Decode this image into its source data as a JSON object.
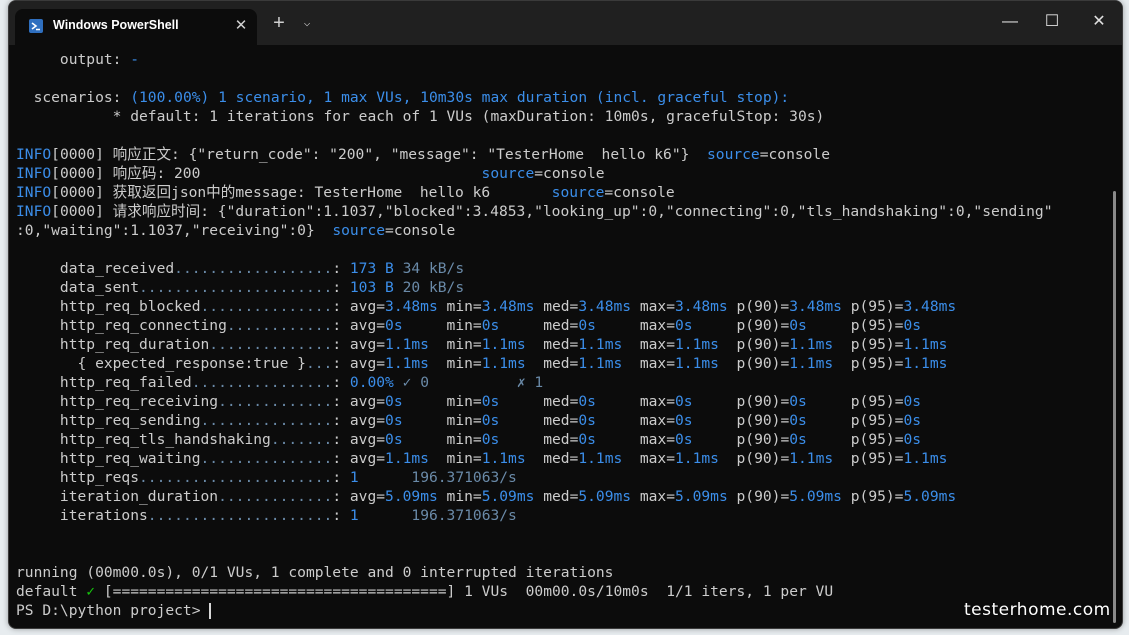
{
  "window": {
    "title": "Windows PowerShell"
  },
  "tabs": {
    "new_tab": "+",
    "dropdown": "⌵",
    "close": "✕"
  },
  "controls": {
    "minimize": "—",
    "maximize": "☐",
    "close": "✕"
  },
  "colors": {
    "default": "#cccccc",
    "blue": "#3b8eea",
    "cyan": "#3b8eea",
    "dim": "#6a8aa8",
    "green": "#16c60c",
    "white": "#f2f2f2"
  },
  "lines": [
    {
      "segments": [
        {
          "text": "     output: "
        },
        {
          "text": "-",
          "color": "cyan"
        }
      ]
    },
    {
      "segments": []
    },
    {
      "segments": [
        {
          "text": "  scenarios: "
        },
        {
          "text": "(100.00%) 1 scenario, 1 max VUs, 10m30s max duration (incl. graceful stop):",
          "color": "cyan"
        }
      ]
    },
    {
      "segments": [
        {
          "text": "           * default: 1 iterations for each of 1 VUs (maxDuration: 10m0s, gracefulStop: 30s)"
        }
      ]
    },
    {
      "segments": []
    },
    {
      "segments": [
        {
          "text": "INFO",
          "color": "cyan"
        },
        {
          "text": "[0000] 响应正文: {\"return_code\": \"200\", \"message\": \"TesterHome  hello k6\"}  "
        },
        {
          "text": "source",
          "color": "cyan"
        },
        {
          "text": "=console"
        }
      ]
    },
    {
      "segments": [
        {
          "text": "INFO",
          "color": "cyan"
        },
        {
          "text": "[0000] 响应码: 200                                "
        },
        {
          "text": "source",
          "color": "cyan"
        },
        {
          "text": "=console"
        }
      ]
    },
    {
      "segments": [
        {
          "text": "INFO",
          "color": "cyan"
        },
        {
          "text": "[0000] 获取返回json中的message: TesterHome  hello k6       "
        },
        {
          "text": "source",
          "color": "cyan"
        },
        {
          "text": "=console"
        }
      ]
    },
    {
      "segments": [
        {
          "text": "INFO",
          "color": "cyan"
        },
        {
          "text": "[0000] 请求响应时间: {\"duration\":1.1037,\"blocked\":3.4853,\"looking_up\":0,\"connecting\":0,\"tls_handshaking\":0,\"sending\""
        }
      ]
    },
    {
      "segments": [
        {
          "text": ":0,\"waiting\":1.1037,\"receiving\":0}  "
        },
        {
          "text": "source",
          "color": "cyan"
        },
        {
          "text": "=console"
        }
      ]
    },
    {
      "segments": []
    },
    {
      "segments": [
        {
          "text": "     data_received"
        },
        {
          "text": "..................",
          "color": "dim"
        },
        {
          "text": ": "
        },
        {
          "text": "173 B",
          "color": "blue"
        },
        {
          "text": " 34 kB/s",
          "color": "dim"
        }
      ]
    },
    {
      "segments": [
        {
          "text": "     data_sent"
        },
        {
          "text": "......................",
          "color": "dim"
        },
        {
          "text": ": "
        },
        {
          "text": "103 B",
          "color": "blue"
        },
        {
          "text": " 20 kB/s",
          "color": "dim"
        }
      ]
    },
    {
      "segments": [
        {
          "text": "     http_req_blocked"
        },
        {
          "text": "...............",
          "color": "dim"
        },
        {
          "text": ": avg="
        },
        {
          "text": "3.48ms",
          "color": "blue"
        },
        {
          "text": " min="
        },
        {
          "text": "3.48ms",
          "color": "blue"
        },
        {
          "text": " med="
        },
        {
          "text": "3.48ms",
          "color": "blue"
        },
        {
          "text": " max="
        },
        {
          "text": "3.48ms",
          "color": "blue"
        },
        {
          "text": " p(90)="
        },
        {
          "text": "3.48ms",
          "color": "blue"
        },
        {
          "text": " p(95)="
        },
        {
          "text": "3.48ms",
          "color": "blue"
        }
      ]
    },
    {
      "segments": [
        {
          "text": "     http_req_connecting"
        },
        {
          "text": "............",
          "color": "dim"
        },
        {
          "text": ": avg="
        },
        {
          "text": "0s",
          "color": "blue"
        },
        {
          "text": "     min="
        },
        {
          "text": "0s",
          "color": "blue"
        },
        {
          "text": "     med="
        },
        {
          "text": "0s",
          "color": "blue"
        },
        {
          "text": "     max="
        },
        {
          "text": "0s",
          "color": "blue"
        },
        {
          "text": "     p(90)="
        },
        {
          "text": "0s",
          "color": "blue"
        },
        {
          "text": "     p(95)="
        },
        {
          "text": "0s",
          "color": "blue"
        }
      ]
    },
    {
      "segments": [
        {
          "text": "     http_req_duration"
        },
        {
          "text": "..............",
          "color": "dim"
        },
        {
          "text": ": avg="
        },
        {
          "text": "1.1ms",
          "color": "blue"
        },
        {
          "text": "  min="
        },
        {
          "text": "1.1ms",
          "color": "blue"
        },
        {
          "text": "  med="
        },
        {
          "text": "1.1ms",
          "color": "blue"
        },
        {
          "text": "  max="
        },
        {
          "text": "1.1ms",
          "color": "blue"
        },
        {
          "text": "  p(90)="
        },
        {
          "text": "1.1ms",
          "color": "blue"
        },
        {
          "text": "  p(95)="
        },
        {
          "text": "1.1ms",
          "color": "blue"
        }
      ]
    },
    {
      "segments": [
        {
          "text": "       { expected_response:true }"
        },
        {
          "text": "...",
          "color": "dim"
        },
        {
          "text": ": avg="
        },
        {
          "text": "1.1ms",
          "color": "blue"
        },
        {
          "text": "  min="
        },
        {
          "text": "1.1ms",
          "color": "blue"
        },
        {
          "text": "  med="
        },
        {
          "text": "1.1ms",
          "color": "blue"
        },
        {
          "text": "  max="
        },
        {
          "text": "1.1ms",
          "color": "blue"
        },
        {
          "text": "  p(90)="
        },
        {
          "text": "1.1ms",
          "color": "blue"
        },
        {
          "text": "  p(95)="
        },
        {
          "text": "1.1ms",
          "color": "blue"
        }
      ]
    },
    {
      "segments": [
        {
          "text": "     http_req_failed"
        },
        {
          "text": "................",
          "color": "dim"
        },
        {
          "text": ": "
        },
        {
          "text": "0.00%",
          "color": "blue"
        },
        {
          "text": " ✓ 0          ✗ 1",
          "color": "dim"
        }
      ]
    },
    {
      "segments": [
        {
          "text": "     http_req_receiving"
        },
        {
          "text": ".............",
          "color": "dim"
        },
        {
          "text": ": avg="
        },
        {
          "text": "0s",
          "color": "blue"
        },
        {
          "text": "     min="
        },
        {
          "text": "0s",
          "color": "blue"
        },
        {
          "text": "     med="
        },
        {
          "text": "0s",
          "color": "blue"
        },
        {
          "text": "     max="
        },
        {
          "text": "0s",
          "color": "blue"
        },
        {
          "text": "     p(90)="
        },
        {
          "text": "0s",
          "color": "blue"
        },
        {
          "text": "     p(95)="
        },
        {
          "text": "0s",
          "color": "blue"
        }
      ]
    },
    {
      "segments": [
        {
          "text": "     http_req_sending"
        },
        {
          "text": "...............",
          "color": "dim"
        },
        {
          "text": ": avg="
        },
        {
          "text": "0s",
          "color": "blue"
        },
        {
          "text": "     min="
        },
        {
          "text": "0s",
          "color": "blue"
        },
        {
          "text": "     med="
        },
        {
          "text": "0s",
          "color": "blue"
        },
        {
          "text": "     max="
        },
        {
          "text": "0s",
          "color": "blue"
        },
        {
          "text": "     p(90)="
        },
        {
          "text": "0s",
          "color": "blue"
        },
        {
          "text": "     p(95)="
        },
        {
          "text": "0s",
          "color": "blue"
        }
      ]
    },
    {
      "segments": [
        {
          "text": "     http_req_tls_handshaking"
        },
        {
          "text": ".......",
          "color": "dim"
        },
        {
          "text": ": avg="
        },
        {
          "text": "0s",
          "color": "blue"
        },
        {
          "text": "     min="
        },
        {
          "text": "0s",
          "color": "blue"
        },
        {
          "text": "     med="
        },
        {
          "text": "0s",
          "color": "blue"
        },
        {
          "text": "     max="
        },
        {
          "text": "0s",
          "color": "blue"
        },
        {
          "text": "     p(90)="
        },
        {
          "text": "0s",
          "color": "blue"
        },
        {
          "text": "     p(95)="
        },
        {
          "text": "0s",
          "color": "blue"
        }
      ]
    },
    {
      "segments": [
        {
          "text": "     http_req_waiting"
        },
        {
          "text": "...............",
          "color": "dim"
        },
        {
          "text": ": avg="
        },
        {
          "text": "1.1ms",
          "color": "blue"
        },
        {
          "text": "  min="
        },
        {
          "text": "1.1ms",
          "color": "blue"
        },
        {
          "text": "  med="
        },
        {
          "text": "1.1ms",
          "color": "blue"
        },
        {
          "text": "  max="
        },
        {
          "text": "1.1ms",
          "color": "blue"
        },
        {
          "text": "  p(90)="
        },
        {
          "text": "1.1ms",
          "color": "blue"
        },
        {
          "text": "  p(95)="
        },
        {
          "text": "1.1ms",
          "color": "blue"
        }
      ]
    },
    {
      "segments": [
        {
          "text": "     http_reqs"
        },
        {
          "text": "......................",
          "color": "dim"
        },
        {
          "text": ": "
        },
        {
          "text": "1",
          "color": "blue"
        },
        {
          "text": "      196.371063/s",
          "color": "dim"
        }
      ]
    },
    {
      "segments": [
        {
          "text": "     iteration_duration"
        },
        {
          "text": ".............",
          "color": "dim"
        },
        {
          "text": ": avg="
        },
        {
          "text": "5.09ms",
          "color": "blue"
        },
        {
          "text": " min="
        },
        {
          "text": "5.09ms",
          "color": "blue"
        },
        {
          "text": " med="
        },
        {
          "text": "5.09ms",
          "color": "blue"
        },
        {
          "text": " max="
        },
        {
          "text": "5.09ms",
          "color": "blue"
        },
        {
          "text": " p(90)="
        },
        {
          "text": "5.09ms",
          "color": "blue"
        },
        {
          "text": " p(95)="
        },
        {
          "text": "5.09ms",
          "color": "blue"
        }
      ]
    },
    {
      "segments": [
        {
          "text": "     iterations"
        },
        {
          "text": ".....................",
          "color": "dim"
        },
        {
          "text": ": "
        },
        {
          "text": "1",
          "color": "blue"
        },
        {
          "text": "      196.371063/s",
          "color": "dim"
        }
      ]
    },
    {
      "segments": []
    },
    {
      "segments": []
    },
    {
      "segments": [
        {
          "text": "running (00m00.0s), 0/1 VUs, 1 complete and 0 interrupted iterations"
        }
      ]
    },
    {
      "segments": [
        {
          "text": "default "
        },
        {
          "text": "✓",
          "color": "green"
        },
        {
          "text": " [======================================] 1 VUs  00m00.0s/10m0s  1/1 iters, 1 per VU"
        }
      ]
    },
    {
      "segments": [
        {
          "text": "PS D:\\python project> "
        }
      ],
      "cursor": true
    }
  ],
  "watermark": "testerhome.com"
}
